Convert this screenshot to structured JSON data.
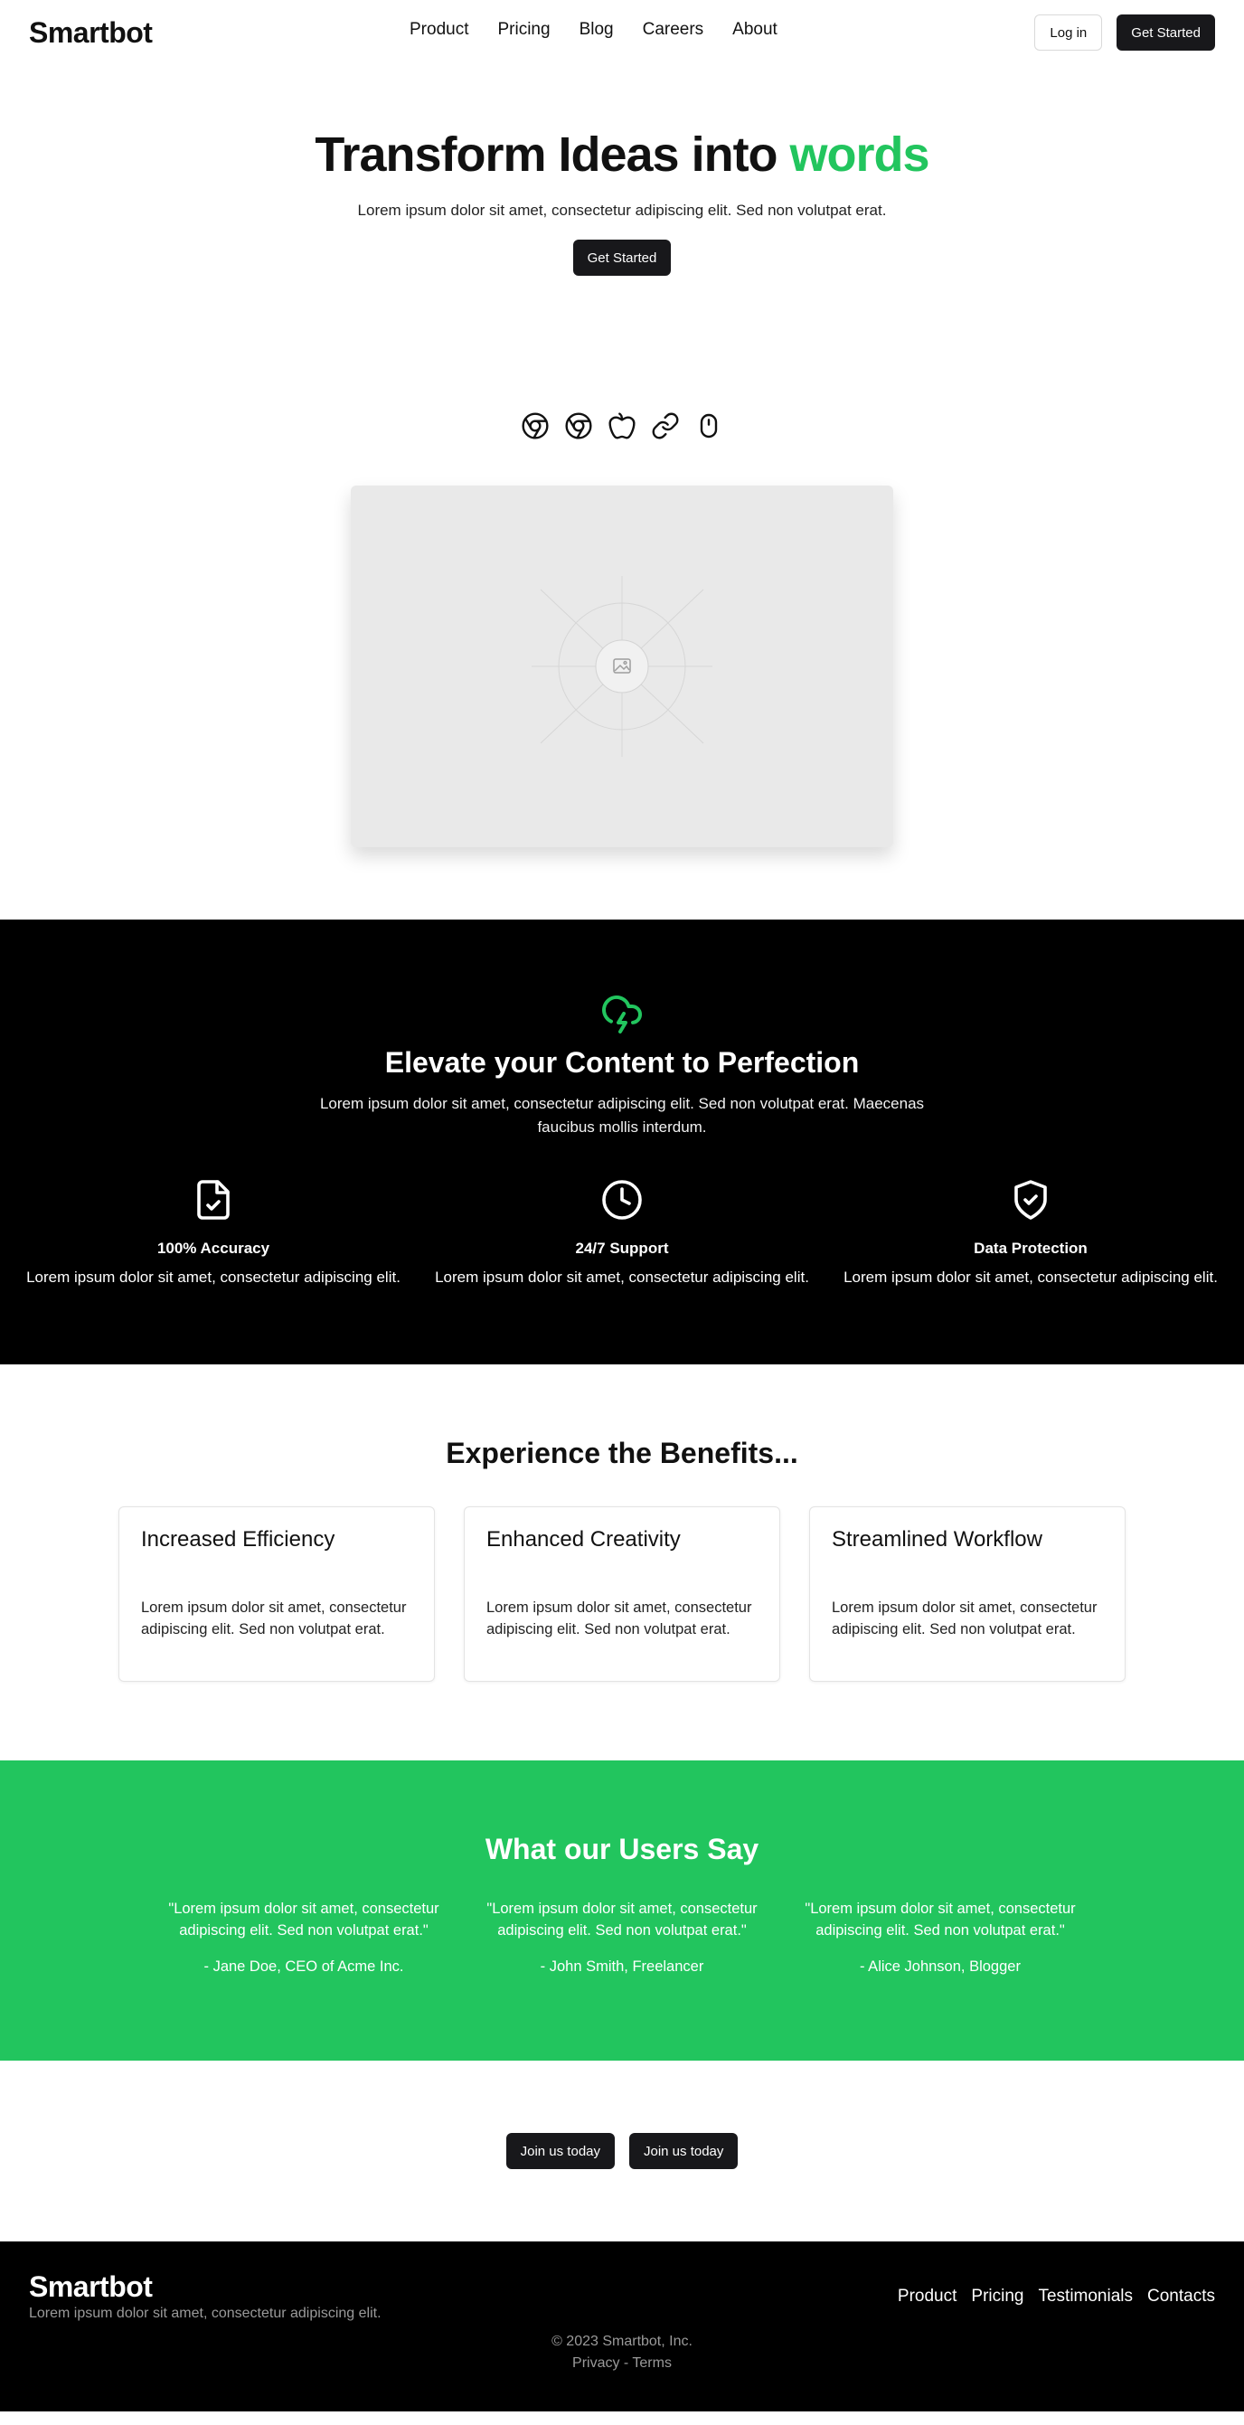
{
  "header": {
    "brand": "Smartbot",
    "nav": [
      "Product",
      "Pricing",
      "Blog",
      "Careers",
      "About"
    ],
    "login_label": "Log in",
    "get_started_label": "Get Started"
  },
  "hero": {
    "title_main": "Transform Ideas into ",
    "title_accent": "words",
    "subtitle": "Lorem ipsum dolor sit amet, consectetur adipiscing elit. Sed non volutpat erat.",
    "cta_label": "Get Started",
    "accent_color": "#22c55e"
  },
  "icon_row": [
    "chrome-icon",
    "chrome-icon",
    "apple-icon",
    "link-icon",
    "mouse-icon"
  ],
  "media": {
    "icon": "image-icon"
  },
  "features": {
    "icon": "cloud-lightning-icon",
    "title": "Elevate your Content to Perfection",
    "lead": "Lorem ipsum dolor sit amet, consectetur adipiscing elit. Sed non volutpat erat. Maecenas faucibus mollis interdum.",
    "items": [
      {
        "icon": "file-check-icon",
        "title": "100% Accuracy",
        "text": "Lorem ipsum dolor sit amet, consectetur adipiscing elit."
      },
      {
        "icon": "clock-icon",
        "title": "24/7 Support",
        "text": "Lorem ipsum dolor sit amet, consectetur adipiscing elit."
      },
      {
        "icon": "shield-check-icon",
        "title": "Data Protection",
        "text": "Lorem ipsum dolor sit amet, consectetur adipiscing elit."
      }
    ]
  },
  "benefits": {
    "title": "Experience the Benefits...",
    "cards": [
      {
        "title": "Increased Efficiency",
        "text": "Lorem ipsum dolor sit amet, consectetur adipiscing elit. Sed non volutpat erat."
      },
      {
        "title": "Enhanced Creativity",
        "text": "Lorem ipsum dolor sit amet, consectetur adipiscing elit. Sed non volutpat erat."
      },
      {
        "title": "Streamlined Workflow",
        "text": "Lorem ipsum dolor sit amet, consectetur adipiscing elit. Sed non volutpat erat."
      }
    ]
  },
  "testimonials": {
    "title": "What our Users Say",
    "bg_color": "#22c55e",
    "items": [
      {
        "quote": "\"Lorem ipsum dolor sit amet, consectetur adipiscing elit. Sed non volutpat erat.\"",
        "author": "- Jane Doe, CEO of Acme Inc."
      },
      {
        "quote": "\"Lorem ipsum dolor sit amet, consectetur adipiscing elit. Sed non volutpat erat.\"",
        "author": "- John Smith, Freelancer"
      },
      {
        "quote": "\"Lorem ipsum dolor sit amet, consectetur adipiscing elit. Sed non volutpat erat.\"",
        "author": "- Alice Johnson, Blogger"
      }
    ]
  },
  "cta": {
    "join_labels": [
      "Join us today",
      "Join us today"
    ]
  },
  "footer": {
    "brand": "Smartbot",
    "tagline": "Lorem ipsum dolor sit amet, consectetur adipiscing elit.",
    "links": [
      "Product",
      "Pricing",
      "Testimonials",
      "Contacts"
    ],
    "copyright": "© 2023 Smartbot, Inc.",
    "privacy_label": "Privacy",
    "separator": " - ",
    "terms_label": "Terms"
  }
}
